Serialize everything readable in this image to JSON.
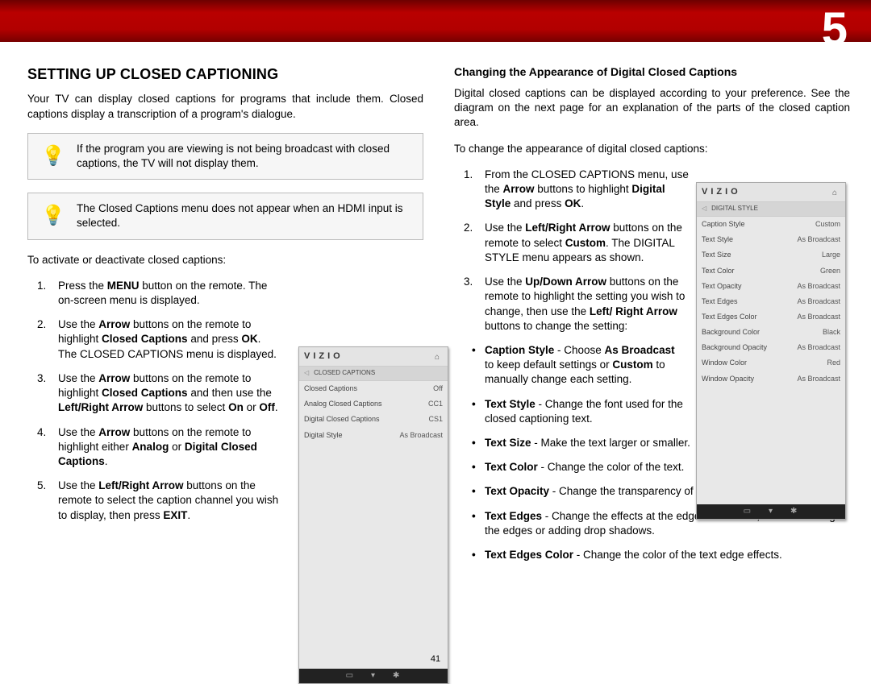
{
  "header": {
    "chapter_number": "5"
  },
  "page_number": "41",
  "left": {
    "h1": "Setting up Closed Captioning",
    "intro": "Your TV can display closed captions for programs that include them. Closed captions display a transcription of a program's dialogue.",
    "note1": "If the program you are viewing is not being broadcast with closed captions, the TV will not display them.",
    "note2": "The Closed Captions menu does not appear when an HDMI input is selected.",
    "lead": "To activate or deactivate closed captions:",
    "steps": [
      {
        "pre": "Press the ",
        "b1": "MENU",
        "post1": " button on the remote. The on-screen menu is displayed."
      },
      {
        "pre": "Use the ",
        "b1": "Arrow",
        "post1": " buttons on the remote to highlight ",
        "b2": "Closed Captions",
        "post2": " and press ",
        "b3": "OK",
        "post3": ". The CLOSED CAPTIONS menu is displayed."
      },
      {
        "pre": "Use the ",
        "b1": "Arrow",
        "post1": " buttons on the remote to highlight ",
        "b2": "Closed Captions",
        "post2": " and then use the ",
        "b3": "Left/Right Arrow",
        "post3": " buttons to select ",
        "b4": "On",
        "post4": " or ",
        "b5": "Off",
        "post5": "."
      },
      {
        "pre": "Use the ",
        "b1": "Arrow",
        "post1": " buttons on the remote to highlight either ",
        "b2": "Analog",
        "post2": " or ",
        "b3": "Digital Closed Captions",
        "post3": "."
      },
      {
        "pre": "Use the ",
        "b1": "Left/Right Arrow",
        "post1": " buttons on the remote to select the caption channel you wish to display, then press ",
        "b2": "EXIT",
        "post2": "."
      }
    ]
  },
  "right": {
    "h2": "Changing the Appearance of Digital Closed Captions",
    "intro": "Digital closed captions can be displayed according to your preference. See the diagram on the next page for an explanation of the parts of the closed caption area.",
    "lead": "To change the appearance of digital closed captions:",
    "steps": [
      {
        "t": "From the CLOSED CAPTIONS menu, use the Arrow buttons to highlight Digital Style and press OK.",
        "b": [
          "Arrow",
          "Digital Style",
          "OK"
        ]
      },
      {
        "t": "Use the Left/Right Arrow buttons on the remote to select Custom. The DIGITAL STYLE menu appears as shown.",
        "b": [
          "Left/Right Arrow",
          "Custom"
        ]
      },
      {
        "t": "Use the Up/Down Arrow buttons on the remote to highlight the setting you wish to change, then use the Left/ Right Arrow buttons to change the setting:",
        "b": [
          "Up/Down Arrow",
          "Left/",
          "Right Arrow"
        ]
      }
    ],
    "bullets": [
      {
        "b": "Caption Style",
        "t": " - Choose ",
        "b2": "As Broadcast",
        "t2": " to keep default settings or ",
        "b3": "Custom",
        "t3": " to manually change each setting.",
        "narrow": true
      },
      {
        "b": "Text Style",
        "t": "  - Change the font used for the closed captioning text.",
        "narrow": true
      },
      {
        "b": "Text Size",
        "t": " - Make the text larger or smaller."
      },
      {
        "b": "Text Color",
        "t": " - Change the color of the text."
      },
      {
        "b": "Text Opacity",
        "t": " - Change the transparency of the text."
      },
      {
        "b": "Text Edges",
        "t": " - Change the effects at the edges of the text, such as raising the edges or adding drop shadows."
      },
      {
        "b": "Text Edges Color",
        "t": " - Change the color of the text edge effects."
      }
    ]
  },
  "panel1": {
    "brand": "VIZIO",
    "crumb": "CLOSED CAPTIONS",
    "rows": [
      {
        "k": "Closed Captions",
        "v": "Off"
      },
      {
        "k": "Analog Closed Captions",
        "v": "CC1"
      },
      {
        "k": "Digital Closed Captions",
        "v": "CS1"
      },
      {
        "k": "Digital Style",
        "v": "As Broadcast"
      }
    ]
  },
  "panel2": {
    "brand": "VIZIO",
    "crumb": "DIGITAL STYLE",
    "rows": [
      {
        "k": "Caption Style",
        "v": "Custom"
      },
      {
        "k": "Text Style",
        "v": "As Broadcast"
      },
      {
        "k": "Text Size",
        "v": "Large"
      },
      {
        "k": "Text Color",
        "v": "Green",
        "cls": "green"
      },
      {
        "k": "Text Opacity",
        "v": "As Broadcast"
      },
      {
        "k": "Text Edges",
        "v": "As Broadcast"
      },
      {
        "k": "Text Edges Color",
        "v": "As Broadcast"
      },
      {
        "k": "Background Color",
        "v": "Black"
      },
      {
        "k": "Background Opacity",
        "v": "As Broadcast"
      },
      {
        "k": "Window Color",
        "v": "Red",
        "cls": "red"
      },
      {
        "k": "Window Opacity",
        "v": "As Broadcast"
      }
    ]
  }
}
